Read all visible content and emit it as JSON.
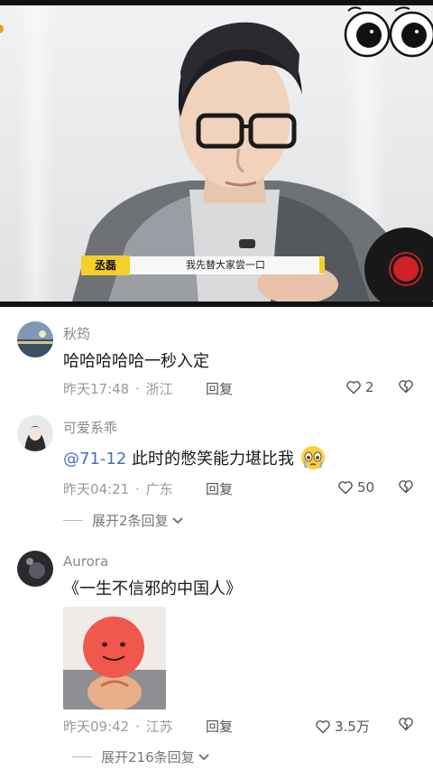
{
  "video": {
    "subtitle_name": "丞磊",
    "subtitle_text": "我先替大家尝一口"
  },
  "comments": [
    {
      "username": "秋筠",
      "text": "哈哈哈哈哈一秒入定",
      "time": "昨天17:48",
      "location": "浙江",
      "reply_label": "回复",
      "likes": "2"
    },
    {
      "username": "可爱系乖",
      "mention": "@71-12",
      "text": "此时的憋笑能力堪比我",
      "time": "昨天04:21",
      "location": "广东",
      "reply_label": "回复",
      "likes": "50",
      "expand_label": "展开2条回复"
    },
    {
      "username": "Aurora",
      "text": "《一生不信邪的中国人》",
      "time": "昨天09:42",
      "location": "江苏",
      "reply_label": "回复",
      "likes": "3.5万",
      "expand_label": "展开216条回复"
    }
  ],
  "separator": "·",
  "colors": {
    "accent_mention": "#4a6fb5",
    "name_tag": "#f4d02a",
    "meta_gray": "#9a9a9a"
  }
}
